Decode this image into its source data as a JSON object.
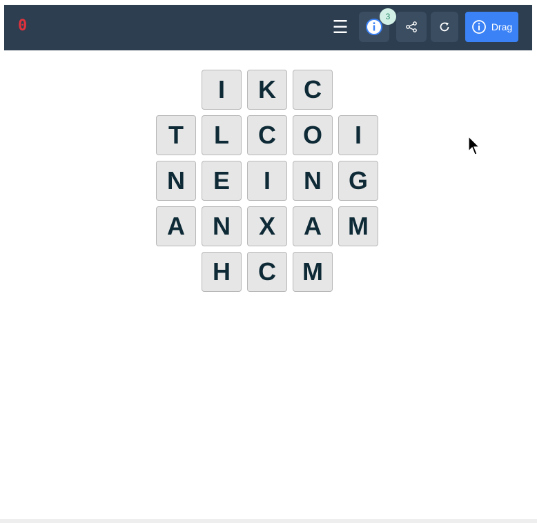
{
  "header": {
    "score": "0",
    "menu_glyph": "☰",
    "hint_badge": "3",
    "drag_label": "Drag"
  },
  "icons": {
    "menu": "hamburger-menu-icon",
    "hint": "info-icon",
    "share": "share-icon",
    "restart": "refresh-icon",
    "drag": "info-icon"
  },
  "colors": {
    "topbar": "#2c3e50",
    "score": "#e0323c",
    "drag_button": "#3b82f6",
    "tile_bg": "#e6e6e6",
    "tile_text": "#0e2a36"
  },
  "board": {
    "rows": [
      [
        "I",
        "K",
        "C"
      ],
      [
        "T",
        "L",
        "C",
        "O",
        "I"
      ],
      [
        "N",
        "E",
        "I",
        "N",
        "G"
      ],
      [
        "A",
        "N",
        "X",
        "A",
        "M"
      ],
      [
        "H",
        "C",
        "M"
      ]
    ]
  }
}
